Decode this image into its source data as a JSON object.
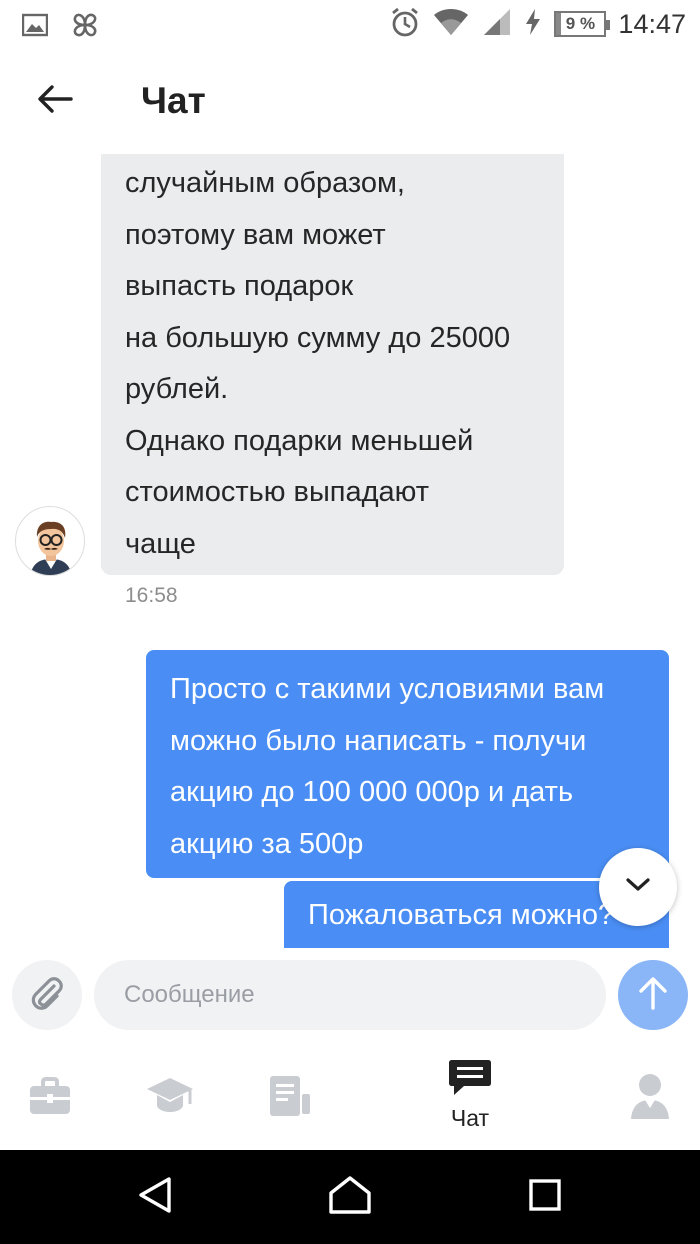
{
  "status_bar": {
    "time": "14:47",
    "battery_text": "9 %",
    "battery_level": 0.09,
    "icons": [
      "image-icon",
      "pinwheel-icon",
      "alarm-icon",
      "wifi-icon",
      "signal-icon",
      "charging-icon",
      "battery-icon"
    ]
  },
  "header": {
    "title": "Чат",
    "back_icon": "arrow-left-icon"
  },
  "messages": {
    "incoming": {
      "lines": [
        "случайным образом,",
        "поэтому вам может",
        "выпасть подарок",
        "на большую сумму до 25000",
        "рублей.",
        "Однако подарки меньшей",
        "стоимостью выпадают",
        "чаще"
      ],
      "time": "16:58"
    },
    "outgoing_1": {
      "lines": [
        "Просто с такими условиями вам",
        "можно было написать - получи",
        "акцию до 100 000 000р и дать",
        "акцию за 500р"
      ]
    },
    "outgoing_2": {
      "text": "Пожаловаться можно?"
    }
  },
  "composer": {
    "placeholder": "Сообщение",
    "attach_icon": "paperclip-icon",
    "send_icon": "arrow-up-icon"
  },
  "bottom_nav": {
    "items": [
      {
        "icon": "briefcase-icon",
        "label": ""
      },
      {
        "icon": "graduation-cap-icon",
        "label": ""
      },
      {
        "icon": "document-icon",
        "label": ""
      },
      {
        "icon": "chat-icon",
        "label": "Чат",
        "active": true
      },
      {
        "icon": "profile-icon",
        "label": ""
      }
    ]
  },
  "colors": {
    "accent": "#4a8ef5",
    "send_disabled": "#8ab6f7",
    "incoming_bubble": "#ebecee",
    "nav_inactive": "#c9ccd1"
  }
}
